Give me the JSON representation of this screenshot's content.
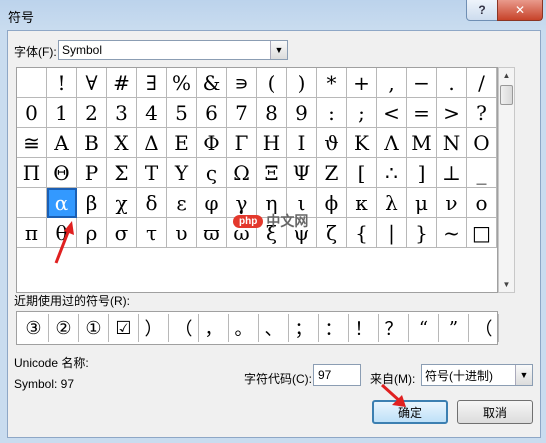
{
  "window": {
    "title": "符号",
    "help_glyph": "?",
    "close_glyph": "✕"
  },
  "font": {
    "label": "字体(F):",
    "value": "Symbol"
  },
  "symbol_grid": {
    "rows": [
      [
        "",
        "!",
        "∀",
        "#",
        "∃",
        "%",
        "&",
        "∍",
        "(",
        ")",
        "*",
        "+",
        ",",
        "−",
        ".",
        "/"
      ],
      [
        "0",
        "1",
        "2",
        "3",
        "4",
        "5",
        "6",
        "7",
        "8",
        "9",
        ":",
        ";",
        "<",
        "=",
        ">",
        "?"
      ],
      [
        "≅",
        "Α",
        "Β",
        "Χ",
        "Δ",
        "Ε",
        "Φ",
        "Γ",
        "Η",
        "Ι",
        "ϑ",
        "Κ",
        "Λ",
        "Μ",
        "Ν",
        "Ο"
      ],
      [
        "Π",
        "Θ",
        "Ρ",
        "Σ",
        "Τ",
        "Υ",
        "ς",
        "Ω",
        "Ξ",
        "Ψ",
        "Ζ",
        "[",
        "∴",
        "]",
        "⊥",
        "_"
      ],
      [
        "",
        "α",
        "β",
        "χ",
        "δ",
        "ε",
        "φ",
        "γ",
        "η",
        "ι",
        "ϕ",
        "κ",
        "λ",
        "μ",
        "ν",
        "ο"
      ],
      [
        "π",
        "θ",
        "ρ",
        "σ",
        "τ",
        "υ",
        "ϖ",
        "ω",
        "ξ",
        "ψ",
        "ζ",
        "{",
        "|",
        "}",
        "~",
        "□"
      ]
    ],
    "selected_row": 4,
    "selected_col": 1
  },
  "recent": {
    "label": "近期使用过的符号(R):",
    "symbols": [
      "③",
      "②",
      "①",
      "☑",
      "）",
      "（",
      "，",
      "。",
      "、",
      "；",
      "：",
      "！",
      "？",
      "“",
      "”",
      "（"
    ]
  },
  "info": {
    "unicode_name_label": "Unicode 名称:",
    "symbol_name": "Symbol: 97"
  },
  "char_code": {
    "label": "字符代码(C):",
    "value": "97"
  },
  "from": {
    "label": "来自(M):",
    "value": "符号(十进制)"
  },
  "buttons": {
    "ok": "确定",
    "cancel": "取消"
  },
  "watermark": {
    "logo": "php",
    "text": "中文网"
  },
  "colors": {
    "selection": "#3399ff",
    "titlebar": "#bcd3ec",
    "close": "#c7432a"
  }
}
